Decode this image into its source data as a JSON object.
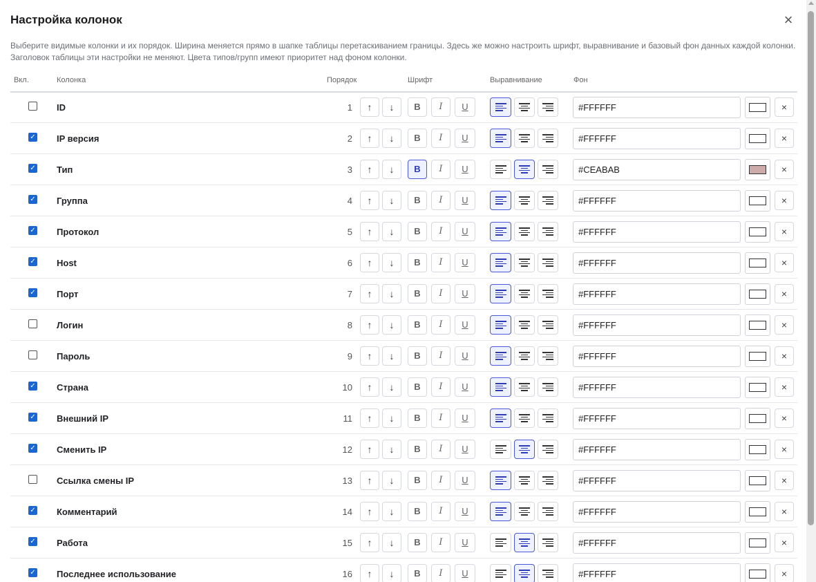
{
  "title": "Настройка колонок",
  "close_label": "×",
  "description": "Выберите видимые колонки и их порядок. Ширина меняется прямо в шапке таблицы перетаскиванием границы. Здесь же можно настроить шрифт, выравнивание и базовый фон данных каждой колонки. Заголовок таблицы эти настройки не меняют. Цвета типов/групп имеют приоритет над фоном колонки.",
  "headers": {
    "enabled": "Вкл.",
    "column": "Колонка",
    "order": "Порядок",
    "font": "Шрифт",
    "align": "Выравнивание",
    "bg": "Фон"
  },
  "labels": {
    "up": "↑",
    "down": "↓",
    "bold": "B",
    "italic": "I",
    "underline": "U",
    "clear": "×"
  },
  "rows": [
    {
      "enabled": false,
      "name": "ID",
      "order": "1",
      "bold": false,
      "align": "left",
      "bg": "#FFFFFF"
    },
    {
      "enabled": true,
      "name": "IP версия",
      "order": "2",
      "bold": false,
      "align": "left",
      "bg": "#FFFFFF"
    },
    {
      "enabled": true,
      "name": "Тип",
      "order": "3",
      "bold": true,
      "align": "center",
      "bg": "#CEABAB"
    },
    {
      "enabled": true,
      "name": "Группа",
      "order": "4",
      "bold": false,
      "align": "left",
      "bg": "#FFFFFF"
    },
    {
      "enabled": true,
      "name": "Протокол",
      "order": "5",
      "bold": false,
      "align": "left",
      "bg": "#FFFFFF"
    },
    {
      "enabled": true,
      "name": "Host",
      "order": "6",
      "bold": false,
      "align": "left",
      "bg": "#FFFFFF"
    },
    {
      "enabled": true,
      "name": "Порт",
      "order": "7",
      "bold": false,
      "align": "left",
      "bg": "#FFFFFF"
    },
    {
      "enabled": false,
      "name": "Логин",
      "order": "8",
      "bold": false,
      "align": "left",
      "bg": "#FFFFFF"
    },
    {
      "enabled": false,
      "name": "Пароль",
      "order": "9",
      "bold": false,
      "align": "left",
      "bg": "#FFFFFF"
    },
    {
      "enabled": true,
      "name": "Страна",
      "order": "10",
      "bold": false,
      "align": "left",
      "bg": "#FFFFFF"
    },
    {
      "enabled": true,
      "name": "Внешний IP",
      "order": "11",
      "bold": false,
      "align": "left",
      "bg": "#FFFFFF"
    },
    {
      "enabled": true,
      "name": "Сменить IP",
      "order": "12",
      "bold": false,
      "align": "center",
      "bg": "#FFFFFF"
    },
    {
      "enabled": false,
      "name": "Ссылка смены IP",
      "order": "13",
      "bold": false,
      "align": "left",
      "bg": "#FFFFFF"
    },
    {
      "enabled": true,
      "name": "Комментарий",
      "order": "14",
      "bold": false,
      "align": "left",
      "bg": "#FFFFFF"
    },
    {
      "enabled": true,
      "name": "Работа",
      "order": "15",
      "bold": false,
      "align": "center",
      "bg": "#FFFFFF"
    },
    {
      "enabled": true,
      "name": "Последнее использование",
      "order": "16",
      "bold": false,
      "align": "center",
      "bg": "#FFFFFF"
    }
  ]
}
